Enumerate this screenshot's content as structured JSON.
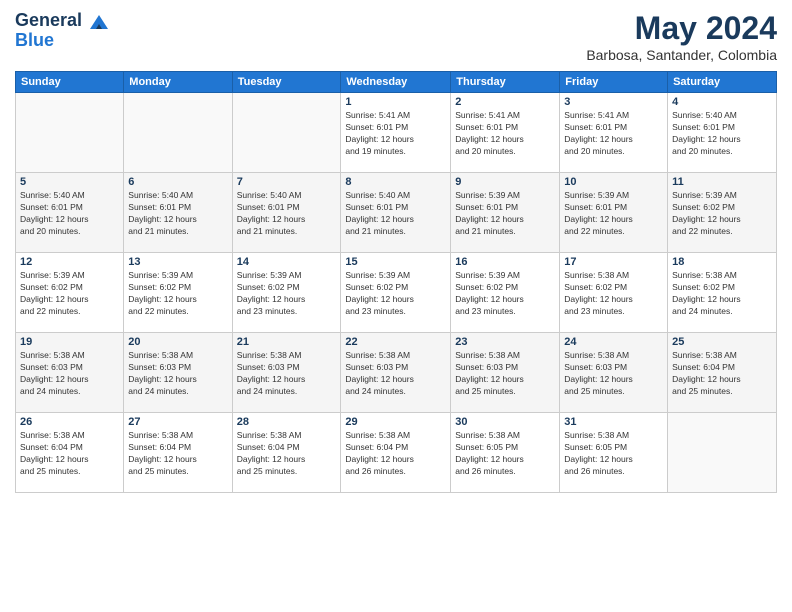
{
  "header": {
    "logo_line1": "General",
    "logo_line2": "Blue",
    "month_title": "May 2024",
    "subtitle": "Barbosa, Santander, Colombia"
  },
  "weekdays": [
    "Sunday",
    "Monday",
    "Tuesday",
    "Wednesday",
    "Thursday",
    "Friday",
    "Saturday"
  ],
  "weeks": [
    [
      {
        "day": "",
        "info": ""
      },
      {
        "day": "",
        "info": ""
      },
      {
        "day": "",
        "info": ""
      },
      {
        "day": "1",
        "info": "Sunrise: 5:41 AM\nSunset: 6:01 PM\nDaylight: 12 hours\nand 19 minutes."
      },
      {
        "day": "2",
        "info": "Sunrise: 5:41 AM\nSunset: 6:01 PM\nDaylight: 12 hours\nand 20 minutes."
      },
      {
        "day": "3",
        "info": "Sunrise: 5:41 AM\nSunset: 6:01 PM\nDaylight: 12 hours\nand 20 minutes."
      },
      {
        "day": "4",
        "info": "Sunrise: 5:40 AM\nSunset: 6:01 PM\nDaylight: 12 hours\nand 20 minutes."
      }
    ],
    [
      {
        "day": "5",
        "info": "Sunrise: 5:40 AM\nSunset: 6:01 PM\nDaylight: 12 hours\nand 20 minutes."
      },
      {
        "day": "6",
        "info": "Sunrise: 5:40 AM\nSunset: 6:01 PM\nDaylight: 12 hours\nand 21 minutes."
      },
      {
        "day": "7",
        "info": "Sunrise: 5:40 AM\nSunset: 6:01 PM\nDaylight: 12 hours\nand 21 minutes."
      },
      {
        "day": "8",
        "info": "Sunrise: 5:40 AM\nSunset: 6:01 PM\nDaylight: 12 hours\nand 21 minutes."
      },
      {
        "day": "9",
        "info": "Sunrise: 5:39 AM\nSunset: 6:01 PM\nDaylight: 12 hours\nand 21 minutes."
      },
      {
        "day": "10",
        "info": "Sunrise: 5:39 AM\nSunset: 6:01 PM\nDaylight: 12 hours\nand 22 minutes."
      },
      {
        "day": "11",
        "info": "Sunrise: 5:39 AM\nSunset: 6:02 PM\nDaylight: 12 hours\nand 22 minutes."
      }
    ],
    [
      {
        "day": "12",
        "info": "Sunrise: 5:39 AM\nSunset: 6:02 PM\nDaylight: 12 hours\nand 22 minutes."
      },
      {
        "day": "13",
        "info": "Sunrise: 5:39 AM\nSunset: 6:02 PM\nDaylight: 12 hours\nand 22 minutes."
      },
      {
        "day": "14",
        "info": "Sunrise: 5:39 AM\nSunset: 6:02 PM\nDaylight: 12 hours\nand 23 minutes."
      },
      {
        "day": "15",
        "info": "Sunrise: 5:39 AM\nSunset: 6:02 PM\nDaylight: 12 hours\nand 23 minutes."
      },
      {
        "day": "16",
        "info": "Sunrise: 5:39 AM\nSunset: 6:02 PM\nDaylight: 12 hours\nand 23 minutes."
      },
      {
        "day": "17",
        "info": "Sunrise: 5:38 AM\nSunset: 6:02 PM\nDaylight: 12 hours\nand 23 minutes."
      },
      {
        "day": "18",
        "info": "Sunrise: 5:38 AM\nSunset: 6:02 PM\nDaylight: 12 hours\nand 24 minutes."
      }
    ],
    [
      {
        "day": "19",
        "info": "Sunrise: 5:38 AM\nSunset: 6:03 PM\nDaylight: 12 hours\nand 24 minutes."
      },
      {
        "day": "20",
        "info": "Sunrise: 5:38 AM\nSunset: 6:03 PM\nDaylight: 12 hours\nand 24 minutes."
      },
      {
        "day": "21",
        "info": "Sunrise: 5:38 AM\nSunset: 6:03 PM\nDaylight: 12 hours\nand 24 minutes."
      },
      {
        "day": "22",
        "info": "Sunrise: 5:38 AM\nSunset: 6:03 PM\nDaylight: 12 hours\nand 24 minutes."
      },
      {
        "day": "23",
        "info": "Sunrise: 5:38 AM\nSunset: 6:03 PM\nDaylight: 12 hours\nand 25 minutes."
      },
      {
        "day": "24",
        "info": "Sunrise: 5:38 AM\nSunset: 6:03 PM\nDaylight: 12 hours\nand 25 minutes."
      },
      {
        "day": "25",
        "info": "Sunrise: 5:38 AM\nSunset: 6:04 PM\nDaylight: 12 hours\nand 25 minutes."
      }
    ],
    [
      {
        "day": "26",
        "info": "Sunrise: 5:38 AM\nSunset: 6:04 PM\nDaylight: 12 hours\nand 25 minutes."
      },
      {
        "day": "27",
        "info": "Sunrise: 5:38 AM\nSunset: 6:04 PM\nDaylight: 12 hours\nand 25 minutes."
      },
      {
        "day": "28",
        "info": "Sunrise: 5:38 AM\nSunset: 6:04 PM\nDaylight: 12 hours\nand 25 minutes."
      },
      {
        "day": "29",
        "info": "Sunrise: 5:38 AM\nSunset: 6:04 PM\nDaylight: 12 hours\nand 26 minutes."
      },
      {
        "day": "30",
        "info": "Sunrise: 5:38 AM\nSunset: 6:05 PM\nDaylight: 12 hours\nand 26 minutes."
      },
      {
        "day": "31",
        "info": "Sunrise: 5:38 AM\nSunset: 6:05 PM\nDaylight: 12 hours\nand 26 minutes."
      },
      {
        "day": "",
        "info": ""
      }
    ]
  ]
}
